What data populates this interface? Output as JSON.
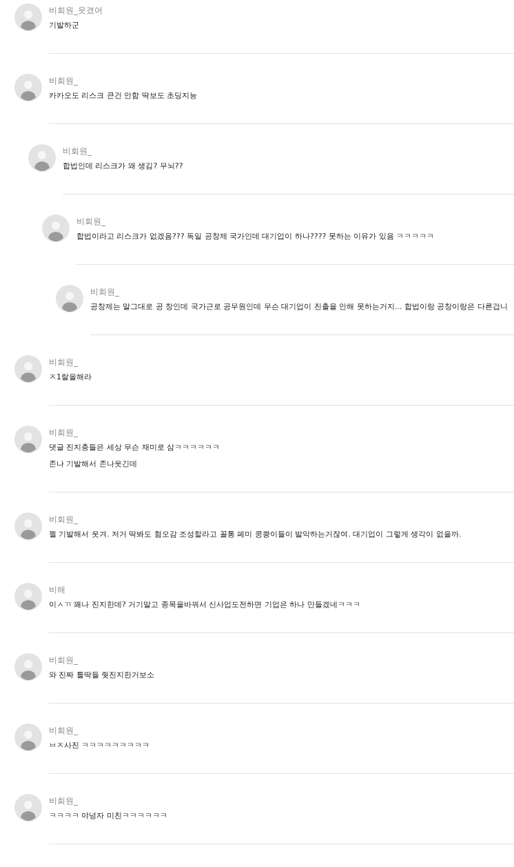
{
  "comments": [
    {
      "author": "비회원_웃겼어",
      "lines": [
        "기발하군"
      ]
    },
    {
      "author": "비회원_",
      "lines": [
        "카카오도 리스크 큰건 안함 딱보도 초딩지능"
      ],
      "children": [
        {
          "author": "비회원_",
          "lines": [
            "합법인데 리스크가 왜 생김? 무뇌??"
          ],
          "children": [
            {
              "author": "비회원_",
              "lines": [
                "합법이라고 리스크가 없겠음??? 독일 공창제 국가인데 대기업이 하나????  못하는 이유가 있음 ㅋㅋㅋㅋㅋ"
              ],
              "children": [
                {
                  "author": "비회원_",
                  "lines": [
                    "공창제는 말그대로 공 창인데 국가근로 공무원인데 무슨 대기업이 진출을 안해 못하는거지... 합법이랑 공창이랑은 다른겁니"
                  ]
                }
              ]
            }
          ]
        }
      ]
    },
    {
      "author": "비회원_",
      "lines": [
        "ㅈ1랄을해라"
      ]
    },
    {
      "author": "비회원_",
      "lines": [
        "댓글 진지충들은 세상 무슨 재미로 삼ㅋㅋㅋㅋㅋㅋ",
        "존나 기발해서 존나웃긴데"
      ]
    },
    {
      "author": "비회원_",
      "lines": [
        "뭘 기발해서 웃겨. 저거 딱봐도 혐오감 조성할라고 꼴통 페미 쿵쾅이들이 발악하는거잖여. 대기업이 그렇게 생각이 없을까."
      ]
    },
    {
      "author": "비해",
      "lines": [
        "이ㅅㄲ 꽤나 진지한데? 거기말고 종목을바꿔서 신사업도전하면 기업은 하나 만들겠네ㅋㅋㅋ"
      ]
    },
    {
      "author": "비회원_",
      "lines": [
        "와 진짜 틀딱들 줫진지한거보소"
      ]
    },
    {
      "author": "비회원_",
      "lines": [
        "ㅂㅈ사진 ㅋㅋㅋㅋㅋㅋㅋㅋㅋ"
      ]
    },
    {
      "author": "비회원_",
      "lines": [
        "ㅋㅋㅋㅋ 야넝자 미친ㅋㅋㅋㅋㅋㅋ"
      ]
    }
  ]
}
